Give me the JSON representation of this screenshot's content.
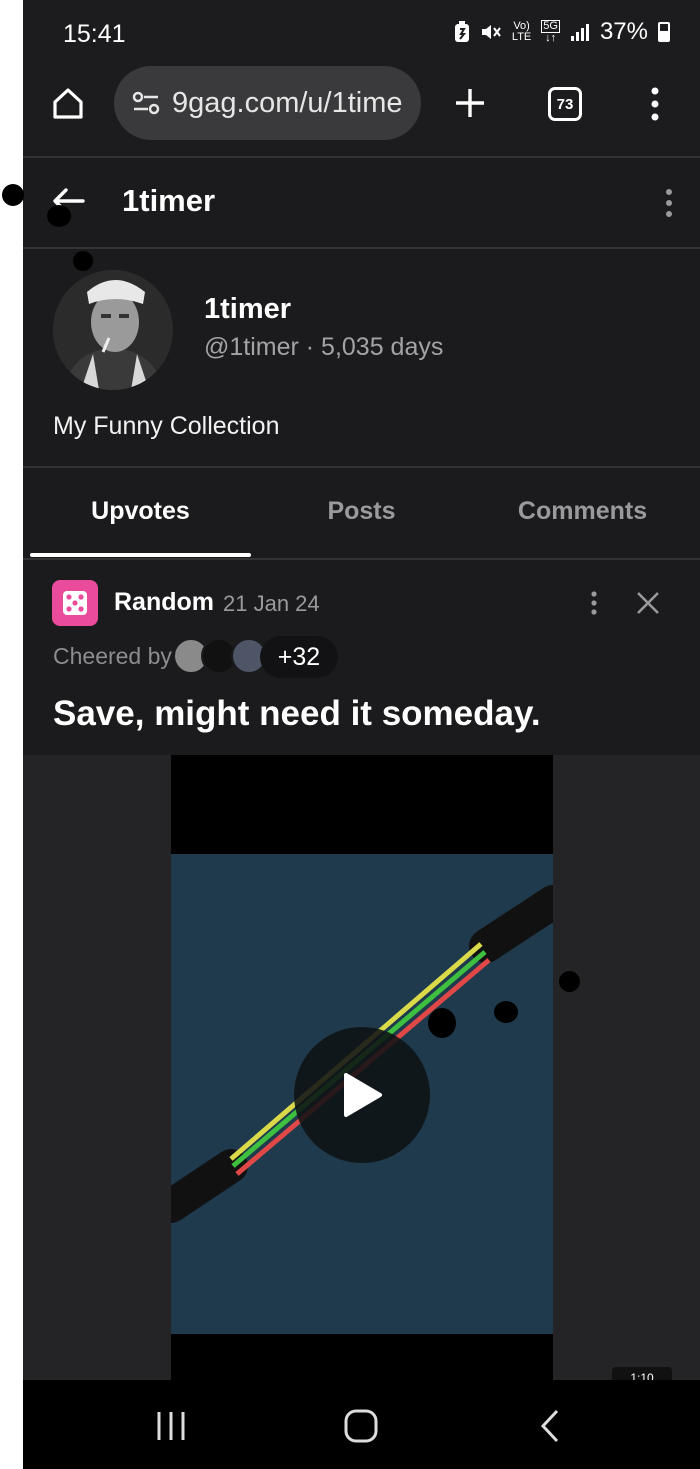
{
  "status_bar": {
    "time": "15:41",
    "network_top": "Vo)",
    "network_bottom": "LTE",
    "fiveg_top": "5G",
    "battery": "37%",
    "icons": [
      "battery-saver-icon",
      "mute-icon",
      "volte-icon",
      "5g-icon",
      "signal-icon",
      "battery-icon"
    ]
  },
  "browser": {
    "url": "9gag.com/u/1time",
    "tab_count": "73",
    "icons": [
      "home-icon",
      "site-settings-icon",
      "plus-icon",
      "tabs-icon",
      "more-vert-icon"
    ]
  },
  "app_header": {
    "title": "1timer"
  },
  "profile": {
    "name": "1timer",
    "handle": "@1timer · 5,035 days",
    "bio": "My Funny Collection"
  },
  "tabs": [
    {
      "label": "Upvotes",
      "active": true
    },
    {
      "label": "Posts",
      "active": false
    },
    {
      "label": "Comments",
      "active": false
    }
  ],
  "post": {
    "section": "Random",
    "date": "21 Jan 24",
    "cheered_label": "Cheered by",
    "cheer_count": "+32",
    "title": "Save, might need it someday.",
    "duration": "1:10",
    "accent_color": "#ea4c9b"
  },
  "navbar": {
    "icons": [
      "recents-icon",
      "home-icon",
      "back-icon"
    ]
  }
}
